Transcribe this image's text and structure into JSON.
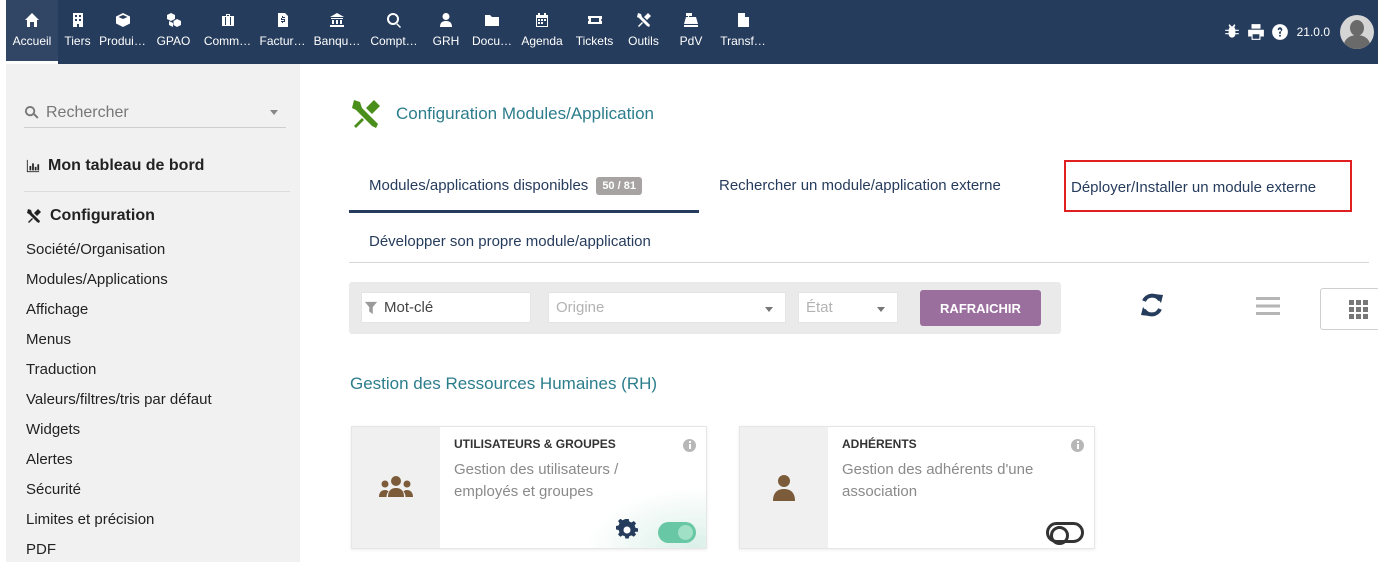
{
  "menu": [
    {
      "label": "Accueil",
      "icon": "home-icon"
    },
    {
      "label": "Tiers",
      "icon": "building-icon"
    },
    {
      "label": "Produi…",
      "icon": "cube-icon"
    },
    {
      "label": "GPAO",
      "icon": "cubes-icon"
    },
    {
      "label": "Comm…",
      "icon": "suitcase-icon"
    },
    {
      "label": "Factur…",
      "icon": "invoice-icon"
    },
    {
      "label": "Banqu…",
      "icon": "bank-icon"
    },
    {
      "label": "Compt…",
      "icon": "search-dollar-icon"
    },
    {
      "label": "GRH",
      "icon": "user-tie-icon"
    },
    {
      "label": "Docu…",
      "icon": "folder-icon"
    },
    {
      "label": "Agenda",
      "icon": "calendar-icon"
    },
    {
      "label": "Tickets",
      "icon": "ticket-icon"
    },
    {
      "label": "Outils",
      "icon": "tools-icon"
    },
    {
      "label": "PdV",
      "icon": "cash-register-icon"
    },
    {
      "label": "Transf…",
      "icon": "file-icon"
    }
  ],
  "top_right": {
    "version": "21.0.0"
  },
  "sidebar": {
    "search_placeholder": "Rechercher",
    "dashboard": "Mon tableau de bord",
    "configuration": "Configuration",
    "items": [
      "Société/Organisation",
      "Modules/Applications",
      "Affichage",
      "Menus",
      "Traduction",
      "Valeurs/filtres/tris par défaut",
      "Widgets",
      "Alertes",
      "Sécurité",
      "Limites et précision",
      "PDF"
    ]
  },
  "page": {
    "title": "Configuration Modules/Application",
    "tabs": {
      "available": "Modules/applications disponibles",
      "available_badge": "50 / 81",
      "search_external": "Rechercher un module/application externe",
      "deploy": "Déployer/Installer un module externe",
      "develop": "Développer son propre module/application"
    },
    "filters": {
      "keyword_value": "Mot-clé",
      "origin_placeholder": "Origine",
      "state_placeholder": "État",
      "refresh": "RAFRAICHIR"
    },
    "section_title": "Gestion des Ressources Humaines (RH)",
    "cards": [
      {
        "title": "UTILISATEURS & GROUPES",
        "desc": "Gestion des utilisateurs / employés et groupes",
        "enabled": true
      },
      {
        "title": "ADHÉRENTS",
        "desc": "Gestion des adhérents d'une association",
        "enabled": false
      }
    ]
  },
  "colors": {
    "topbar": "#263c5c",
    "accent_teal": "#2c7d8c",
    "refresh_button": "#9a6f9e",
    "toggle_on": "#68c7a4",
    "highlight_border": "#e02020"
  }
}
